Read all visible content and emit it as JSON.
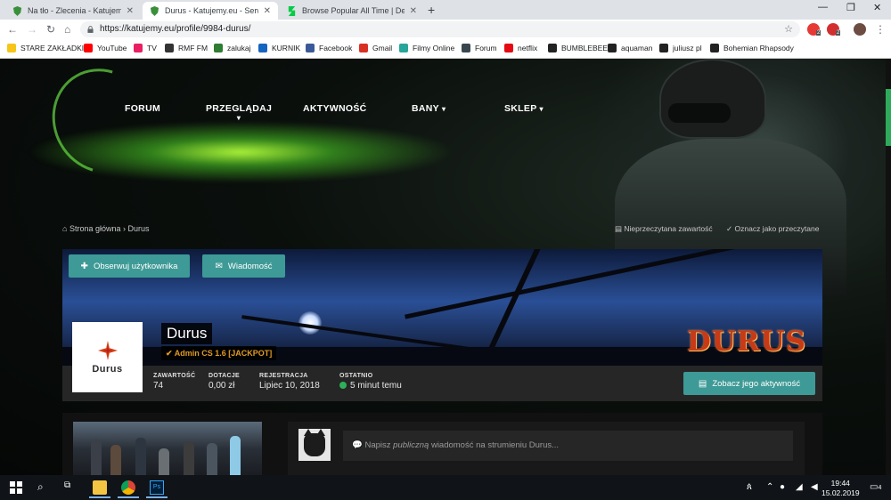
{
  "browser": {
    "tabs": [
      {
        "title": "Na tło - Zlecenia - Katujemy.eu",
        "active": false
      },
      {
        "title": "Durus - Katujemy.eu - Serwery C",
        "active": true
      },
      {
        "title": "Browse Popular All Time | Devian",
        "active": false
      }
    ],
    "new_tab": "+",
    "url": "https://katujemy.eu/profile/9984-durus/",
    "badges": {
      "ext1": "2",
      "ext2": "2"
    },
    "bookmarks": [
      "STARE ZAKŁADKI",
      "YouTube",
      "TV",
      "RMF FM",
      "zalukaj",
      "KURNIK",
      "Facebook",
      "Gmail",
      "Filmy Online",
      "Forum",
      "netflix",
      "BUMBLEBEE",
      "aquaman",
      "juliusz pl",
      "Bohemian Rhapsody"
    ]
  },
  "site": {
    "nav": [
      {
        "label": "FORUM"
      },
      {
        "label": "PRZEGLĄDAJ",
        "caret": "▾"
      },
      {
        "label": "AKTYWNOŚĆ"
      },
      {
        "label": "BANY",
        "caret": "▾"
      },
      {
        "label": "SKLEP",
        "caret": "▾"
      }
    ],
    "breadcrumb": {
      "home": "Strona główna",
      "separator": "›",
      "current": "Durus"
    },
    "links": {
      "unread": "Nieprzeczytana zawartość",
      "mark_read": "Oznacz jako przeczytane"
    }
  },
  "profile": {
    "follow_button": "Obserwuj użytkownika",
    "message_button": "Wiadomość",
    "name": "Durus",
    "group": "Admin CS 1.6 [JACKPOT]",
    "avatar_text": "Durus",
    "cover_logo": "DURUS",
    "stats": [
      {
        "label": "ZAWARTOŚĆ",
        "value": "74"
      },
      {
        "label": "DOTACJE",
        "value": "0,00 zł"
      },
      {
        "label": "REJESTRACJA",
        "value": "Lipiec 10, 2018"
      },
      {
        "label": "OSTATNIO",
        "value": "5 minut temu"
      }
    ],
    "activity_button": "Zobacz jego aktywność",
    "stream_placeholder_pre": "Napisz ",
    "stream_placeholder_em": "publiczną",
    "stream_placeholder_post": " wiadomość na strumieniu Durus..."
  },
  "taskbar": {
    "time": "19:44",
    "date": "15.02.2019",
    "notifications": "4"
  },
  "colors": {
    "teal_button": "#3e9a96",
    "group_orange": "#e09a25",
    "online_green": "#2eaf5a",
    "logo_red": "#c83a16"
  }
}
